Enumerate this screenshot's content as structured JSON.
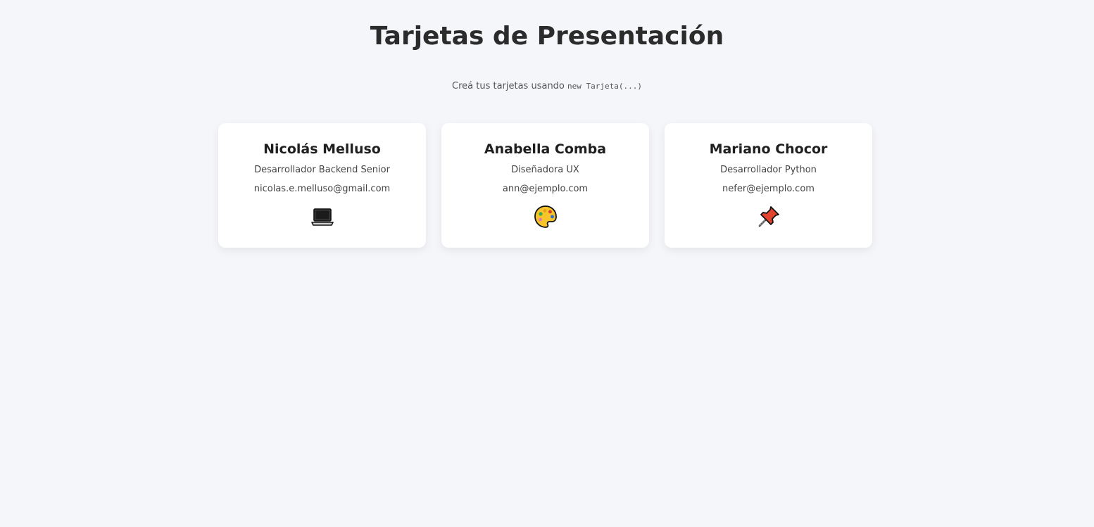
{
  "header": {
    "title": "Tarjetas de Presentación",
    "subtitle_text": "Creá tus tarjetas usando",
    "subtitle_code": "new Tarjeta(...)"
  },
  "cards": [
    {
      "name": "Nicolás Melluso",
      "role": "Desarrollador Backend Senior",
      "email": "nicolas.e.melluso@gmail.com",
      "icon": "laptop-icon"
    },
    {
      "name": "Anabella Comba",
      "role": "Diseñadora UX",
      "email": "ann@ejemplo.com",
      "icon": "palette-icon"
    },
    {
      "name": "Mariano Chocor",
      "role": "Desarrollador Python",
      "email": "nefer@ejemplo.com",
      "icon": "pushpin-icon"
    }
  ],
  "colors": {
    "background": "#f5f6fa",
    "card": "#ffffff",
    "text": "#2b2b2b"
  }
}
